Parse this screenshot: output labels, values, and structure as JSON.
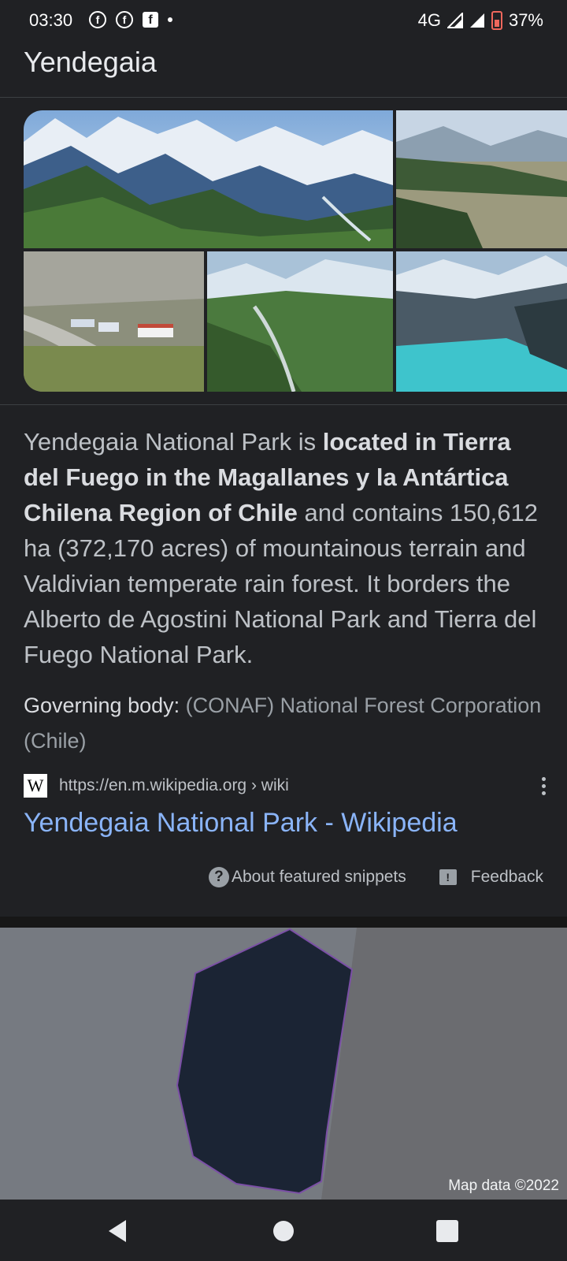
{
  "status_bar": {
    "time": "03:30",
    "network": "4G",
    "battery": "37%"
  },
  "header": {
    "title": "Yendegaia"
  },
  "snippet": {
    "text_before": "Yendegaia National Park is ",
    "text_bold": "located in Tierra del Fuego in the Magallanes y la Antártica Chilena Region of Chile",
    "text_after": " and contains 150,612 ha (372,170 acres) of mountainous terrain and Valdivian temperate rain forest. It borders the Alberto de Agostini National Park and Tierra del Fuego National Park.",
    "governing_label": "Governing body:",
    "governing_value": "(CONAF) National Forest Corporation (Chile)"
  },
  "source": {
    "logo": "W",
    "url": "https://en.m.wikipedia.org › wiki",
    "title": "Yendegaia National Park - Wikipedia"
  },
  "footer": {
    "about": "About featured snippets",
    "feedback": "Feedback"
  },
  "map": {
    "attribution": "Map data ©2022"
  },
  "colors": {
    "background": "#202124",
    "link": "#8ab4f8",
    "map_polygon": "#1b2434",
    "map_land": "#767a81"
  }
}
